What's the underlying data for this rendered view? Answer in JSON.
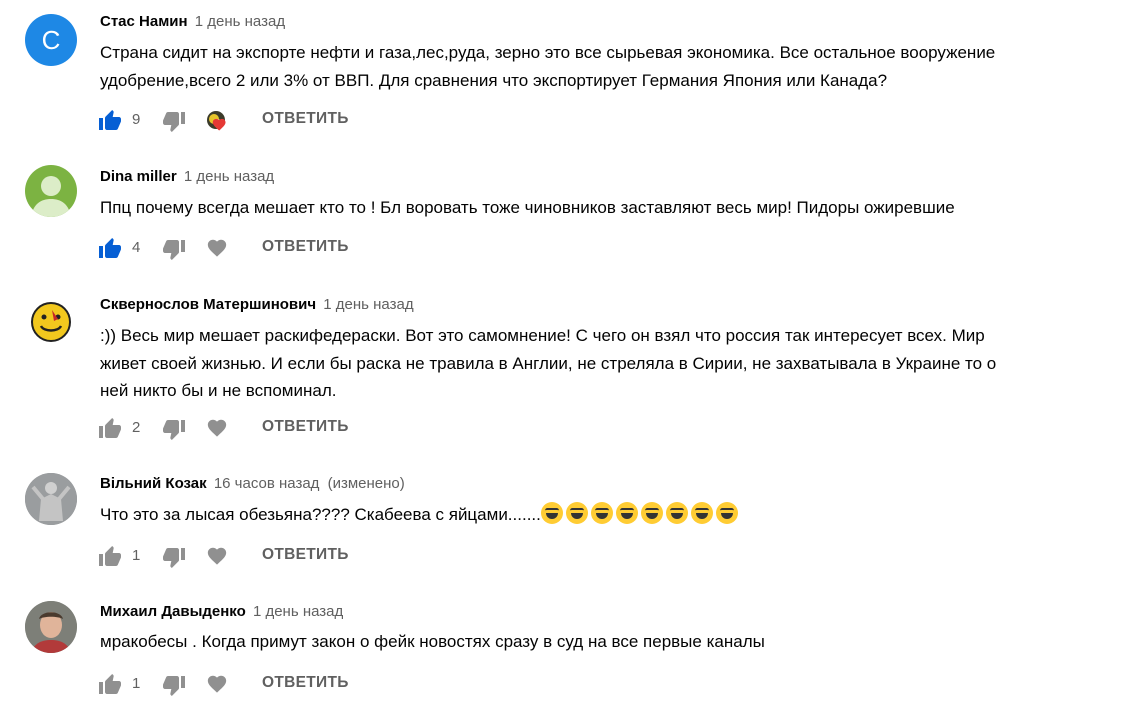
{
  "comments": [
    {
      "author": "Стас Намин",
      "time": "1 день назад",
      "avatar_letter": "С",
      "text_lines": [
        "Страна сидит на экспорте нефти и газа,лес,руда, зерно это все сырьевая экономика. Все остальное вооружение",
        "удобрение,всего 2 или 3% от ВВП.  Для сравнения что экспортирует Германия Япония или Канада?"
      ],
      "likes": "9",
      "reply": "ОТВЕТИТЬ"
    },
    {
      "author": "Dina miller",
      "time": "1 день назад",
      "text_lines": [
        "Ппц почему всегда мешает кто то ! Бл воровать тоже чиновников заставляют весь мир! Пидоры ожиревшие"
      ],
      "likes": "4",
      "reply": "ОТВЕТИТЬ"
    },
    {
      "author": "Сквернослов Матершинович",
      "time": "1 день назад",
      "text_lines": [
        ":)) Весь мир мешает раскифедераски. Вот это самомнение! С чего он взял что россия так интересует всех. Мир",
        "живет своей жизнью. И если бы раска не травила в Англии, не стреляла в Сирии, не захватывала в Украине то о",
        "ней никто бы и не вспоминал."
      ],
      "likes": "2",
      "reply": "ОТВЕТИТЬ"
    },
    {
      "author": "Вільний Козак",
      "time": "16 часов назад",
      "edited": "(изменено)",
      "text_lines": [
        "Что это за лысая обезьяна???? Скабеева с яйцами......."
      ],
      "emoji_count": 8,
      "likes": "1",
      "reply": "ОТВЕТИТЬ"
    },
    {
      "author": "Михаил Давыденко",
      "time": "1 день назад",
      "text_lines": [
        "мракобесы . Когда примут   закон о фейк новостях сразу в суд на все первые каналы"
      ],
      "likes": "1",
      "reply": "ОТВЕТИТЬ"
    }
  ],
  "icons": {
    "like": "thumbs-up-icon",
    "dislike": "thumbs-down-icon",
    "heart": "heart-icon",
    "creator_heart": "creator-heart-badge-icon",
    "emoji": "rolling-laughing-emoji-icon"
  },
  "colors": {
    "like_active": "#065fd4",
    "icon_gray": "#909090",
    "avatar_blue": "#1e88e5",
    "avatar_green": "#7cb342",
    "heart_red": "#e53935"
  }
}
